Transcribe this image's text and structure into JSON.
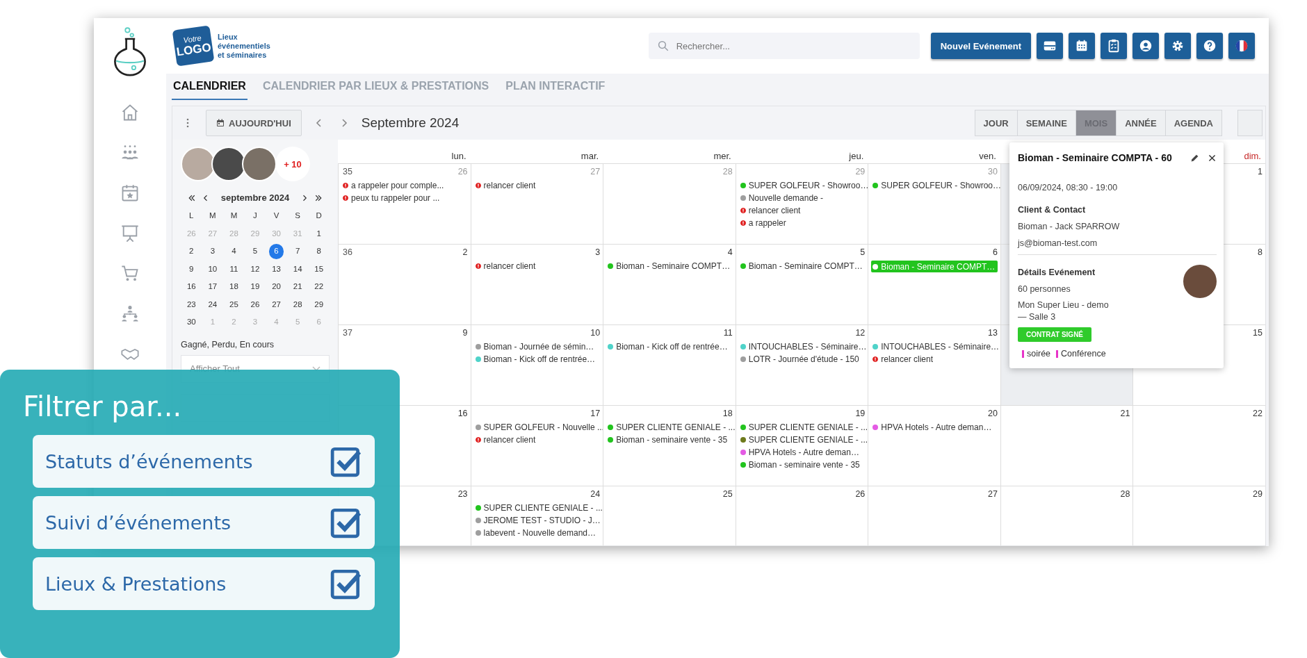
{
  "header": {
    "logo": {
      "word_top": "Votre",
      "word_main": "LOGO",
      "tagline": [
        "Lieux",
        "événementiels",
        "et séminaires"
      ]
    },
    "search": {
      "placeholder": "Rechercher..."
    },
    "new_event_button": "Nouvel Evénement"
  },
  "tabs": [
    {
      "label": "CALENDRIER",
      "selected": true
    },
    {
      "label": "CALENDRIER PAR LIEUX & PRESTATIONS",
      "selected": false
    },
    {
      "label": "PLAN INTERACTIF",
      "selected": false
    }
  ],
  "toolbar": {
    "today_button": "AUJOURD'HUI",
    "period": "Septembre 2024",
    "views": [
      {
        "label": "JOUR",
        "selected": false
      },
      {
        "label": "SEMAINE",
        "selected": false
      },
      {
        "label": "MOIS",
        "selected": true
      },
      {
        "label": "ANNÉE",
        "selected": false
      },
      {
        "label": "AGENDA",
        "selected": false
      }
    ]
  },
  "side_panel": {
    "more_count": "+ 10",
    "mini_calendar": {
      "month": "septembre 2024",
      "weekdays": [
        "L",
        "M",
        "M",
        "J",
        "V",
        "S",
        "D"
      ],
      "days": [
        {
          "label": "26",
          "muted": true,
          "selected": false
        },
        {
          "label": "27",
          "muted": true,
          "selected": false
        },
        {
          "label": "28",
          "muted": true,
          "selected": false
        },
        {
          "label": "29",
          "muted": true,
          "selected": false
        },
        {
          "label": "30",
          "muted": true,
          "selected": false
        },
        {
          "label": "31",
          "muted": true,
          "selected": false
        },
        {
          "label": "1",
          "muted": false,
          "selected": false
        },
        {
          "label": "2",
          "muted": false,
          "selected": false
        },
        {
          "label": "3",
          "muted": false,
          "selected": false
        },
        {
          "label": "4",
          "muted": false,
          "selected": false
        },
        {
          "label": "5",
          "muted": false,
          "selected": false
        },
        {
          "label": "6",
          "muted": false,
          "selected": true
        },
        {
          "label": "7",
          "muted": false,
          "selected": false
        },
        {
          "label": "8",
          "muted": false,
          "selected": false
        },
        {
          "label": "9",
          "muted": false,
          "selected": false
        },
        {
          "label": "10",
          "muted": false,
          "selected": false
        },
        {
          "label": "11",
          "muted": false,
          "selected": false
        },
        {
          "label": "12",
          "muted": false,
          "selected": false
        },
        {
          "label": "13",
          "muted": false,
          "selected": false
        },
        {
          "label": "14",
          "muted": false,
          "selected": false
        },
        {
          "label": "15",
          "muted": false,
          "selected": false
        },
        {
          "label": "16",
          "muted": false,
          "selected": false
        },
        {
          "label": "17",
          "muted": false,
          "selected": false
        },
        {
          "label": "18",
          "muted": false,
          "selected": false
        },
        {
          "label": "19",
          "muted": false,
          "selected": false
        },
        {
          "label": "20",
          "muted": false,
          "selected": false
        },
        {
          "label": "21",
          "muted": false,
          "selected": false
        },
        {
          "label": "22",
          "muted": false,
          "selected": false
        },
        {
          "label": "23",
          "muted": false,
          "selected": false
        },
        {
          "label": "24",
          "muted": false,
          "selected": false
        },
        {
          "label": "25",
          "muted": false,
          "selected": false
        },
        {
          "label": "26",
          "muted": false,
          "selected": false
        },
        {
          "label": "27",
          "muted": false,
          "selected": false
        },
        {
          "label": "28",
          "muted": false,
          "selected": false
        },
        {
          "label": "29",
          "muted": false,
          "selected": false
        },
        {
          "label": "30",
          "muted": false,
          "selected": false
        },
        {
          "label": "1",
          "muted": true,
          "selected": false
        },
        {
          "label": "2",
          "muted": true,
          "selected": false
        },
        {
          "label": "3",
          "muted": true,
          "selected": false
        },
        {
          "label": "4",
          "muted": true,
          "selected": false
        },
        {
          "label": "5",
          "muted": true,
          "selected": false
        },
        {
          "label": "6",
          "muted": true,
          "selected": false
        }
      ]
    },
    "status_label": "Gagné, Perdu, En cours",
    "status_select": "Afficher Tout"
  },
  "calendar": {
    "weekdays": [
      {
        "label": "lun.",
        "weekend": false
      },
      {
        "label": "mar.",
        "weekend": false
      },
      {
        "label": "mer.",
        "weekend": false
      },
      {
        "label": "jeu.",
        "weekend": false
      },
      {
        "label": "ven.",
        "weekend": false
      },
      {
        "label": "dim.",
        "weekend": true
      }
    ],
    "weeks": [
      {
        "number": "35",
        "days": [
          {
            "num": "26",
            "muted": true,
            "events": [
              {
                "kind": "alert",
                "text": "a rappeler pour comple...",
                "selected": false
              },
              {
                "kind": "alert",
                "text": "peux tu rappeler pour ...",
                "selected": false
              }
            ]
          },
          {
            "num": "27",
            "muted": true,
            "events": [
              {
                "kind": "alert",
                "text": "relancer client",
                "selected": false
              }
            ]
          },
          {
            "num": "28",
            "muted": true
          },
          {
            "num": "29",
            "muted": true,
            "events": [
              {
                "kind": "dot",
                "color": "#22c41e",
                "text": "SUPER GOLFEUR - Showroo…",
                "selected": false
              },
              {
                "kind": "dot",
                "color": "#9e9e9e",
                "text": "Nouvelle demande -",
                "selected": false
              },
              {
                "kind": "alert",
                "text": "relancer client",
                "selected": false
              },
              {
                "kind": "alert",
                "text": "a rappeler",
                "selected": false
              }
            ]
          },
          {
            "num": "30",
            "muted": true,
            "events": [
              {
                "kind": "dot",
                "color": "#22c41e",
                "text": "SUPER GOLFEUR - Showroo…",
                "selected": false
              }
            ]
          },
          {
            "covered": true
          },
          {
            "num": "1",
            "muted": false
          }
        ]
      },
      {
        "number": "36",
        "days": [
          {
            "num": "2",
            "muted": false
          },
          {
            "num": "3",
            "muted": false,
            "events": [
              {
                "kind": "alert",
                "text": "relancer client",
                "selected": false
              }
            ]
          },
          {
            "num": "4",
            "muted": false,
            "events": [
              {
                "kind": "dot",
                "color": "#22c41e",
                "text": "Bioman - Seminaire COMPT…",
                "selected": false
              }
            ]
          },
          {
            "num": "5",
            "muted": false,
            "events": [
              {
                "kind": "dot",
                "color": "#22c41e",
                "text": "Bioman - Seminaire COMPT…",
                "selected": false
              }
            ]
          },
          {
            "num": "6",
            "muted": false,
            "events": [
              {
                "kind": "dot",
                "color": "#22c41e",
                "text": "Bioman - Seminaire COMPT…",
                "selected": true
              }
            ]
          },
          {
            "covered": true
          },
          {
            "num": "8",
            "muted": false
          }
        ]
      },
      {
        "number": "37",
        "days": [
          {
            "num": "9",
            "muted": false
          },
          {
            "num": "10",
            "muted": false,
            "events": [
              {
                "kind": "dot",
                "color": "#9e9e9e",
                "text": "Bioman - Journée de sémin…",
                "selected": false
              },
              {
                "kind": "dot",
                "color": "#4fd3c9",
                "text": "Bioman - Kick off de rentrée…",
                "selected": false
              }
            ]
          },
          {
            "num": "11",
            "muted": false,
            "events": [
              {
                "kind": "dot",
                "color": "#4fd3c9",
                "text": "Bioman - Kick off de rentrée…",
                "selected": false
              }
            ]
          },
          {
            "num": "12",
            "muted": false,
            "events": [
              {
                "kind": "dot",
                "color": "#4fd3c9",
                "text": "INTOUCHABLES - Séminaire…",
                "selected": false
              },
              {
                "kind": "dot",
                "color": "#9e9e9e",
                "text": "LOTR - Journée d'étude - 150",
                "selected": false
              }
            ]
          },
          {
            "num": "13",
            "muted": false,
            "events": [
              {
                "kind": "dot",
                "color": "#4fd3c9",
                "text": "INTOUCHABLES - Séminaire…",
                "selected": false
              },
              {
                "kind": "alert",
                "text": "relancer client",
                "selected": false
              }
            ]
          },
          {
            "covered": true
          },
          {
            "num": "15",
            "muted": false
          }
        ]
      },
      {
        "days": [
          {
            "num": "16",
            "muted": false
          },
          {
            "num": "17",
            "muted": false,
            "events": [
              {
                "kind": "dot",
                "color": "#9e9e9e",
                "text": "SUPER GOLFEUR - Nouvelle ...",
                "selected": false
              },
              {
                "kind": "alert",
                "text": "relancer client",
                "selected": false
              }
            ]
          },
          {
            "num": "18",
            "muted": false,
            "events": [
              {
                "kind": "dot",
                "color": "#22c41e",
                "text": "SUPER CLIENTE GENIALE - ...",
                "selected": false
              },
              {
                "kind": "dot",
                "color": "#22c41e",
                "text": "Bioman - seminaire vente - 35",
                "selected": false
              }
            ]
          },
          {
            "num": "19",
            "muted": false,
            "events": [
              {
                "kind": "dot",
                "color": "#22c41e",
                "text": "SUPER CLIENTE GENIALE - ...",
                "selected": false
              },
              {
                "kind": "dot",
                "color": "#6e7a1c",
                "text": "SUPER CLIENTE GENIALE - ...",
                "selected": false
              },
              {
                "kind": "dot",
                "color": "#e45be4",
                "text": "HPVA Hotels - Autre deman…",
                "selected": false
              },
              {
                "kind": "dot",
                "color": "#22c41e",
                "text": "Bioman - seminaire vente - 35",
                "selected": false
              }
            ]
          },
          {
            "num": "20",
            "muted": false,
            "events": [
              {
                "kind": "dot",
                "color": "#e45be4",
                "text": "HPVA Hotels - Autre deman…",
                "selected": false
              }
            ]
          },
          {
            "num": "21",
            "muted": false
          },
          {
            "num": "22",
            "muted": false
          }
        ]
      },
      {
        "days": [
          {
            "num": "23",
            "muted": false
          },
          {
            "num": "24",
            "muted": false,
            "events": [
              {
                "kind": "dot",
                "color": "#22c41e",
                "text": "SUPER CLIENTE GENIALE - ...",
                "selected": false
              },
              {
                "kind": "dot",
                "color": "#9e9e9e",
                "text": "JEROME TEST - STUDIO - J…",
                "selected": false
              },
              {
                "kind": "dot",
                "color": "#9e9e9e",
                "text": "labevent - Nouvelle demand…",
                "selected": false
              }
            ]
          },
          {
            "num": "25",
            "muted": false
          },
          {
            "num": "26",
            "muted": false
          },
          {
            "num": "27",
            "muted": false
          },
          {
            "num": "28",
            "muted": false
          },
          {
            "num": "29",
            "muted": false
          }
        ]
      }
    ]
  },
  "event_popup": {
    "title": "Bioman - Seminaire COMPTA - 60",
    "datetime": "06/09/2024, 08:30 - 19:00",
    "client_heading": "Client & Contact",
    "client": "Bioman - Jack SPARROW",
    "email": "js@bioman-test.com",
    "details_heading": "Détails Evénement",
    "people": "60 personnes",
    "venue": [
      "Mon Super Lieu - demo",
      "— Salle 3"
    ],
    "status_badge": "CONTRAT SIGNÉ",
    "tags": [
      {
        "label": "soirée",
        "color": "#e834c8"
      },
      {
        "label": "Conférence",
        "color": "#e834c8"
      }
    ]
  },
  "filter_overlay": {
    "title": "Filtrer par...",
    "items": [
      {
        "label": "Statuts d’événements",
        "checked": true
      },
      {
        "label": "Suivi d’événements",
        "checked": true
      },
      {
        "label": "Lieux & Prestations",
        "checked": true
      }
    ]
  }
}
